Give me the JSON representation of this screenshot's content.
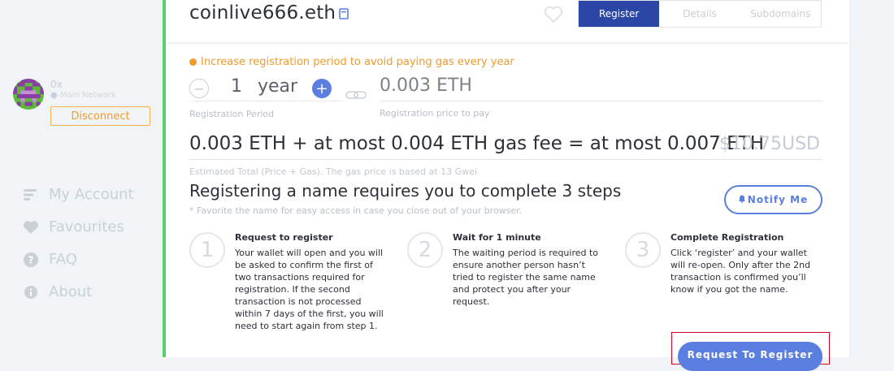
{
  "sidebar": {
    "address": "0x",
    "network": "Main Network",
    "disconnect_label": "Disconnect",
    "items": [
      {
        "label": "My Account",
        "icon": "account-icon"
      },
      {
        "label": "Favourites",
        "icon": "heart-icon"
      },
      {
        "label": "FAQ",
        "icon": "question-icon"
      },
      {
        "label": "About",
        "icon": "info-icon"
      }
    ]
  },
  "header": {
    "domain": "coinlive666.eth",
    "tabs": [
      "Register",
      "Details",
      "Subdomains"
    ],
    "active_tab": "Register"
  },
  "registration": {
    "warning": "Increase registration period to avoid paying gas every year",
    "years": "1",
    "year_unit": "year",
    "period_label": "Registration Period",
    "price": "0.003 ETH",
    "price_label": "Registration price to pay",
    "total": "0.003 ETH + at most 0.004 ETH gas fee = at most 0.007 ETH",
    "usd": "$10.75USD",
    "total_label": "Estimated Total (Price + Gas). The gas price is based at 13 Gwei"
  },
  "steps_section": {
    "title": "Registering a name requires you to complete 3 steps",
    "note": "* Favorite the name for easy access in case you close out of your browser.",
    "notify_label": "Notify Me",
    "steps": [
      {
        "number": "1",
        "title": "Request to register",
        "text": "Your wallet will open and you will be asked to confirm the first of two transactions required for registration. If the second transaction is not processed within 7 days of the first, you will need to start again from step 1."
      },
      {
        "number": "2",
        "title": "Wait for 1 minute",
        "text": "The waiting period is required to ensure another person hasn’t tried to register the same name and protect you after your request."
      },
      {
        "number": "3",
        "title": "Complete Registration",
        "text": "Click ‘register’ and your wallet will re-open. Only after the 2nd transaction is confirmed you’ll know if you got the name."
      }
    ],
    "request_label": "Request To Register"
  },
  "colors": {
    "accent": "#5b7fe0",
    "active_tab": "#2c46a6",
    "warning": "#f29a2c",
    "green_bar": "#5ad16b",
    "highlight_border": "#d0021b"
  }
}
